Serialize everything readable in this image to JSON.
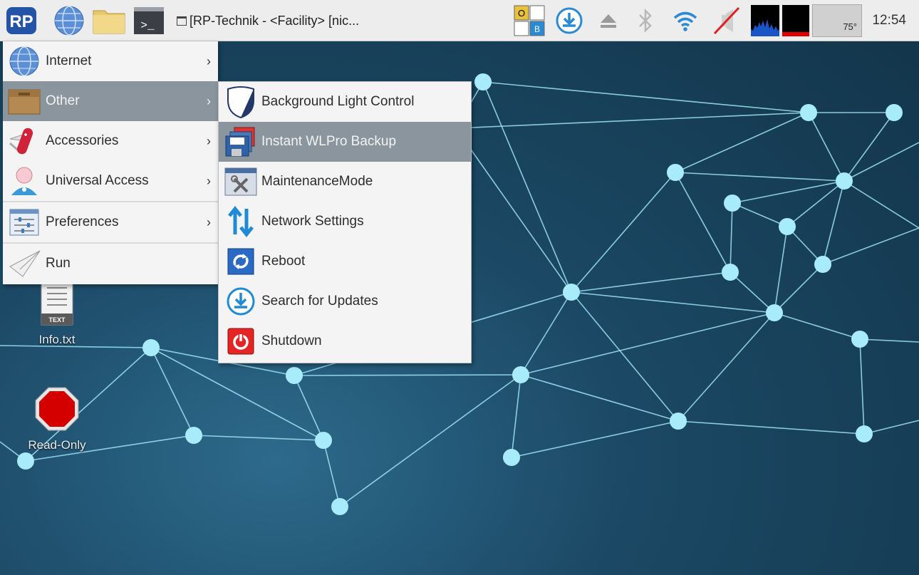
{
  "panel": {
    "launchers": [
      {
        "name": "logo",
        "text": "RP"
      },
      {
        "name": "web-browser-icon"
      },
      {
        "name": "file-manager-icon"
      },
      {
        "name": "terminal-icon",
        "text": ">_"
      }
    ],
    "task_title": "[RP-Technik - <Facility> [nic...",
    "keyboard_indicators": {
      "top": "O",
      "bottom": "B"
    },
    "cpu_temp": "75°",
    "clock": "12:54",
    "colors": {
      "accent_blue": "#2a8ad4",
      "cpu_graph": "#1a55c8",
      "mem_bar": "#e00000"
    }
  },
  "main_menu": {
    "items": [
      {
        "label": "Internet",
        "icon": "globe-icon",
        "submenu": true
      },
      {
        "label": "Other",
        "icon": "box-icon",
        "submenu": true,
        "selected": true
      },
      {
        "label": "Accessories",
        "icon": "swiss-knife-icon",
        "submenu": true
      },
      {
        "label": "Universal Access",
        "icon": "person-icon",
        "submenu": true
      },
      {
        "label": "Preferences",
        "icon": "sliders-icon",
        "submenu": true
      },
      {
        "label": "Run",
        "icon": "paper-plane-icon",
        "submenu": false
      }
    ],
    "arrow": "›"
  },
  "sub_menu": {
    "items": [
      {
        "label": "Background Light Control",
        "icon": "shield-icon"
      },
      {
        "label": "Instant WLPro Backup",
        "icon": "floppy-icon",
        "selected": true
      },
      {
        "label": "MaintenanceMode",
        "icon": "tools-icon"
      },
      {
        "label": "Network Settings",
        "icon": "updown-arrows-icon"
      },
      {
        "label": "Reboot",
        "icon": "reboot-icon"
      },
      {
        "label": "Search for Updates",
        "icon": "download-icon"
      },
      {
        "label": "Shutdown",
        "icon": "power-icon"
      }
    ]
  },
  "desktop": {
    "icons": [
      {
        "label": "Info.txt",
        "icon": "text-file-icon",
        "badge": "TEXT"
      },
      {
        "label": "Read-Only",
        "icon": "stop-sign-icon"
      }
    ]
  }
}
